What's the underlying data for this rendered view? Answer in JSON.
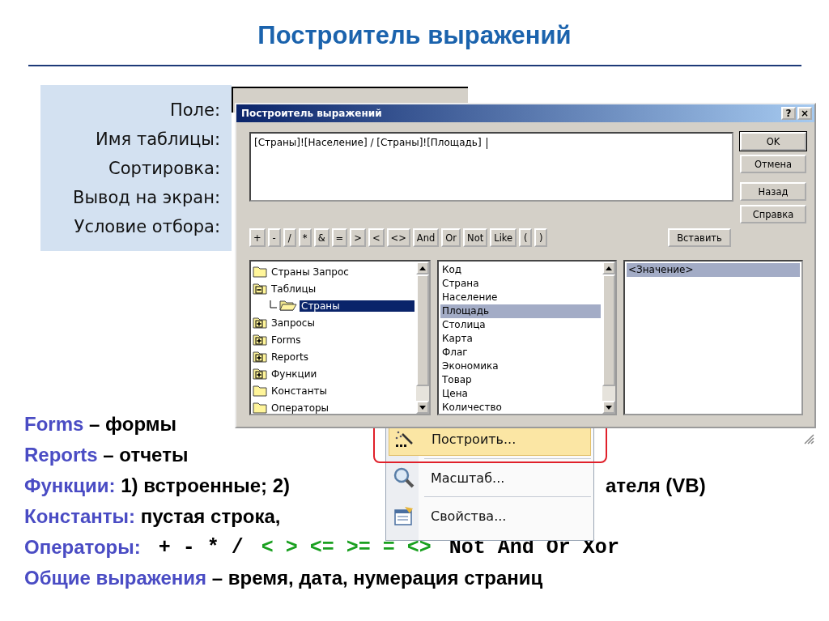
{
  "title": "Построитель выражений",
  "field_panel": {
    "labels": [
      "Поле:",
      "Имя таблицы:",
      "Сортировка:",
      "Вывод на экран:",
      "Условие отбора:"
    ]
  },
  "dialog": {
    "title": "Построитель выражений",
    "help_button": "?",
    "close_button": "×",
    "expression": "[Страны]![Население] / [Страны]![Площадь]",
    "side_buttons": [
      {
        "label": "OK",
        "default": true
      },
      {
        "label": "Отмена",
        "default": false
      },
      {
        "label": "Назад",
        "default": false
      },
      {
        "label": "Справка",
        "default": false
      }
    ],
    "operators": [
      "+",
      "-",
      "/",
      "*",
      "&",
      "=",
      ">",
      "<",
      "<>",
      "And",
      "Or",
      "Not",
      "Like",
      "(",
      ")"
    ],
    "insert_button": "Вставить",
    "tree": [
      {
        "label": "Страны Запрос",
        "kind": "folder",
        "selected": false
      },
      {
        "label": "Таблицы",
        "kind": "group",
        "expanded": true,
        "selected": false,
        "children": [
          {
            "label": "Страны",
            "kind": "open-folder",
            "selected": true
          }
        ]
      },
      {
        "label": "Запросы",
        "kind": "group",
        "expanded": false,
        "selected": false
      },
      {
        "label": "Forms",
        "kind": "group",
        "expanded": false,
        "selected": false
      },
      {
        "label": "Reports",
        "kind": "group",
        "expanded": false,
        "selected": false
      },
      {
        "label": "Функции",
        "kind": "group",
        "expanded": false,
        "selected": false
      },
      {
        "label": "Константы",
        "kind": "folder",
        "selected": false
      },
      {
        "label": "Операторы",
        "kind": "folder",
        "selected": false
      }
    ],
    "fields": [
      {
        "label": "Код",
        "selected": false
      },
      {
        "label": "Страна",
        "selected": false
      },
      {
        "label": "Население",
        "selected": false
      },
      {
        "label": "Площадь",
        "selected": true
      },
      {
        "label": "Столица",
        "selected": false
      },
      {
        "label": "Карта",
        "selected": false
      },
      {
        "label": "Флаг",
        "selected": false
      },
      {
        "label": "Экономика",
        "selected": false
      },
      {
        "label": "Товар",
        "selected": false
      },
      {
        "label": "Цена",
        "selected": false
      },
      {
        "label": "Количество",
        "selected": false
      }
    ],
    "values": [
      {
        "label": "<Значение>",
        "selected": true
      }
    ]
  },
  "context_menu": {
    "items": [
      {
        "label": "Построить...",
        "kind": "build",
        "selected": true
      },
      {
        "label": "Масштаб...",
        "kind": "zoom",
        "selected": false
      },
      {
        "label": "Свойства...",
        "kind": "properties",
        "selected": false
      }
    ]
  },
  "notes": [
    [
      {
        "text": "Forms",
        "kind": "term"
      },
      {
        "text": " – формы",
        "kind": "text"
      }
    ],
    [
      {
        "text": "Reports",
        "kind": "term"
      },
      {
        "text": " – отчеты",
        "kind": "text"
      }
    ],
    [
      {
        "text": "Функции:",
        "kind": "term"
      },
      {
        "text": " 1) встроенные; 2)",
        "kind": "text"
      },
      {
        "text": "ателя (VB)",
        "kind": "tail"
      }
    ],
    [
      {
        "text": "Константы:",
        "kind": "term"
      },
      {
        "text": " пустая строка,",
        "kind": "text"
      }
    ],
    [
      {
        "text": "Операторы:",
        "kind": "term"
      },
      {
        "text": "+ - * /",
        "kind": "op"
      },
      {
        "text": "< > <= >= = <>",
        "kind": "compare"
      },
      {
        "text": "Not And Or Xor",
        "kind": "op"
      }
    ],
    [
      {
        "text": "Общие выражения",
        "kind": "term"
      },
      {
        "text": " – время, дата, нумерация страниц",
        "kind": "text"
      }
    ]
  ]
}
